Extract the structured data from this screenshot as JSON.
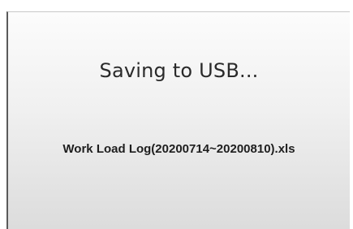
{
  "dialog": {
    "title": "Saving to USB...",
    "filename": "Work Load Log(20200714~20200810).xls"
  },
  "colors": {
    "background_top": "#fcfcfc",
    "background_bottom": "#dcdcdc",
    "text": "#2a2a2a"
  }
}
